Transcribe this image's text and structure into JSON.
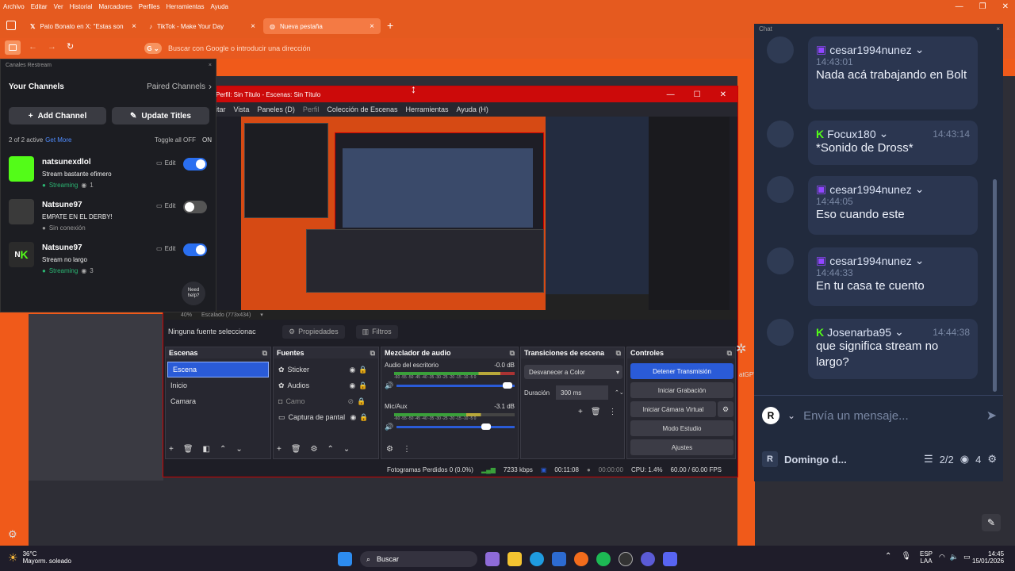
{
  "browser": {
    "menu": [
      "Archivo",
      "Editar",
      "Ver",
      "Historial",
      "Marcadores",
      "Perfiles",
      "Herramientas",
      "Ayuda"
    ],
    "tabs": [
      {
        "label": "Pato Bonato en X: \"Estas son las"
      },
      {
        "label": "TikTok - Make Your Day"
      },
      {
        "label": "Nueva pestaña"
      }
    ],
    "omnibox_placeholder": "Buscar con Google o introducir una dirección"
  },
  "restream": {
    "panel_title": "Canales Restream",
    "your_channels": "Your Channels",
    "paired_channels": "Paired Channels",
    "add_channel": "Add Channel",
    "update_titles": "Update Titles",
    "active_count": "2 of 2 active",
    "get_more": "Get More",
    "toggle_all": "Toggle all OFF",
    "on_label": "ON",
    "need_help": "Need help?",
    "channels": [
      {
        "name": "natsunexdlol",
        "title": "Stream bastante efimero",
        "status": "Streaming",
        "viewers": "1",
        "edit": "Edit",
        "enabled": true
      },
      {
        "name": "Natsune97",
        "title": "EMPATE EN EL DERBY!",
        "status": "Sin conexión",
        "edit": "Edit",
        "enabled": false
      },
      {
        "name": "Natsune97",
        "title": "Stream no largo",
        "status": "Streaming",
        "viewers": "3",
        "edit": "Edit",
        "enabled": true
      }
    ]
  },
  "obs": {
    "title": "Perfil: Sin Título - Escenas: Sin Título",
    "menu": [
      "itar",
      "Vista",
      "Paneles (D)",
      "Perfil",
      "Colección de Escenas",
      "Herramientas",
      "Ayuda (H)"
    ],
    "zoom_label": "40%",
    "scale_label": "Escalado (773x434)",
    "no_source": "Ninguna fuente seleccionac",
    "properties": "Propiedades",
    "filters": "Filtros",
    "scenes_title": "Escenas",
    "scenes": [
      "Escena",
      "Inicio",
      "Camara"
    ],
    "sources_title": "Fuentes",
    "sources": [
      "Sticker",
      "Audios",
      "Camo",
      "Captura de pantal"
    ],
    "mixer_title": "Mezclador de audio",
    "mixer": [
      {
        "name": "Audio del escritorio",
        "db": "-0.0 dB",
        "level": 0.98
      },
      {
        "name": "Mic/Aux",
        "db": "-3.1 dB",
        "level": 0.8
      }
    ],
    "meter_ticks": "-60 -55 -50 -45 -40 -35 -30 -25 -20 -15 -10 -5 0",
    "transitions_title": "Transiciones de escena",
    "transition": "Desvanecer a Color",
    "duration_label": "Duración",
    "duration": "300 ms",
    "controls_title": "Controles",
    "controls": [
      "Detener Transmisión",
      "Iniciar Grabación",
      "Iniciar Cámara Virtual",
      "Modo Estudio",
      "Ajustes"
    ],
    "status": {
      "dropped": "Fotogramas Perdidos 0 (0.0%)",
      "kbps": "7233 kbps",
      "live": "00:11:08",
      "rec": "00:00:00",
      "cpu": "CPU: 1.4%",
      "fps": "60.00 / 60.00 FPS"
    }
  },
  "chat": {
    "title": "Chat",
    "messages": [
      {
        "user": "cesar1994nunez",
        "platform": "twitch",
        "time": "14:43:01",
        "text": "Nada acá trabajando en Bolt"
      },
      {
        "user": "Focux180",
        "platform": "kick",
        "time": "14:43:14",
        "text": "*Sonido de Dross*"
      },
      {
        "user": "cesar1994nunez",
        "platform": "twitch",
        "time": "14:44:05",
        "text": "Eso cuando este"
      },
      {
        "user": "cesar1994nunez",
        "platform": "twitch",
        "time": "14:44:33",
        "text": "En tu casa te cuento"
      },
      {
        "user": "Josenarba95",
        "platform": "kick",
        "time": "14:44:38",
        "text": "que significa stream no largo?"
      }
    ],
    "input_placeholder": "Envía un mensaje...",
    "footer_user": "Domingo d...",
    "channels_count": "2/2",
    "viewers": "4",
    "side_label": "atGPT"
  },
  "taskbar": {
    "weather_temp": "36°C",
    "weather_desc": "Mayorm. soleado",
    "search": "Buscar",
    "lang": "ESP",
    "lang2": "LAA",
    "time": "14:45",
    "date": "15/01/2026"
  },
  "colors": {
    "accent": "#f05a1a",
    "twitch": "#9146ff",
    "kick": "#53fc18",
    "obs_blue": "#2a5bd7"
  }
}
